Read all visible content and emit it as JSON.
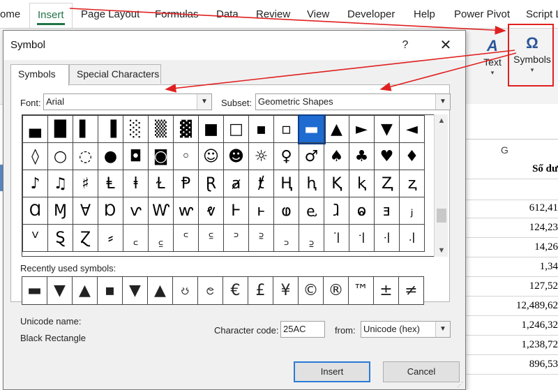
{
  "ribbon": {
    "tabs": [
      {
        "label": "ome"
      },
      {
        "label": "Insert"
      },
      {
        "label": "Page Layout"
      },
      {
        "label": "Formulas"
      },
      {
        "label": "Data"
      },
      {
        "label": "Review"
      },
      {
        "label": "View"
      },
      {
        "label": "Developer"
      },
      {
        "label": "Help"
      },
      {
        "label": "Power Pivot"
      },
      {
        "label": "Script L"
      }
    ],
    "text_button": "Text",
    "symbols_button": "Symbols"
  },
  "sheet": {
    "column_letter": "G",
    "column_header": "Số dư",
    "values": [
      "612,41",
      "124,23",
      "14,26",
      "1,34",
      "127,52",
      "12,489,62",
      "1,246,32",
      "1,238,72",
      "896,53"
    ]
  },
  "dialog": {
    "title": "Symbol",
    "help": "?",
    "close": "✕",
    "tabs": [
      "Symbols",
      "Special Characters"
    ],
    "font_label": "Font:",
    "font_value": "Arial",
    "subset_label": "Subset:",
    "subset_value": "Geometric Shapes",
    "symbol_grid": [
      [
        "▄",
        "█",
        "▌",
        "▐",
        "░",
        "▒",
        "▓",
        "■",
        "□",
        "▪",
        "▫",
        "▬",
        "▲",
        "►",
        "▼",
        "◄"
      ],
      [
        "◊",
        "○",
        "◌",
        "●",
        "◘",
        "◙",
        "◦",
        "☺",
        "☻",
        "☼",
        "♀",
        "♂",
        "♠",
        "♣",
        "♥",
        "♦"
      ],
      [
        "♪",
        "♫",
        "♯",
        "Ⱡ",
        "ⱡ",
        "Ɫ",
        "Ᵽ",
        "Ɽ",
        "ⱥ",
        "ⱦ",
        "Ⱨ",
        "ⱨ",
        "Ⱪ",
        "ⱪ",
        "Ⱬ",
        "ⱬ"
      ],
      [
        "Ɑ",
        "Ɱ",
        "Ɐ",
        "Ɒ",
        "ⱱ",
        "Ⱳ",
        "ⱳ",
        "ⱴ",
        "Ⱶ",
        "ⱶ",
        "ⱷ",
        "ⱸ",
        "ⱹ",
        "ⱺ",
        "ⱻ",
        "ⱼ"
      ],
      [
        "ⱽ",
        "Ȿ",
        "Ɀ",
        "⸗",
        "꜀",
        "꜁",
        "꜂",
        "꜃",
        "꜄",
        "꜅",
        "꜆",
        "꜇",
        "꜈",
        "꜉",
        "꜊",
        "꜋"
      ]
    ],
    "selected_symbol": "▬",
    "recent_label": "Recently used symbols:",
    "recent_symbols": [
      "▬",
      "▼",
      "▲",
      "▪",
      "▼",
      "▲",
      "ၓ",
      "ၔ",
      "€",
      "£",
      "¥",
      "©",
      "®",
      "™",
      "±",
      "≠"
    ],
    "unicode_name_label": "Unicode name:",
    "unicode_name_value": "Black Rectangle",
    "char_code_label": "Character code:",
    "char_code_value": "25AC",
    "from_label": "from:",
    "from_value": "Unicode (hex)",
    "insert_button": "Insert",
    "cancel_button": "Cancel"
  },
  "colors": {
    "accent": "#217346",
    "selection": "#1e6bd1",
    "annotation_red": "#e02020"
  }
}
